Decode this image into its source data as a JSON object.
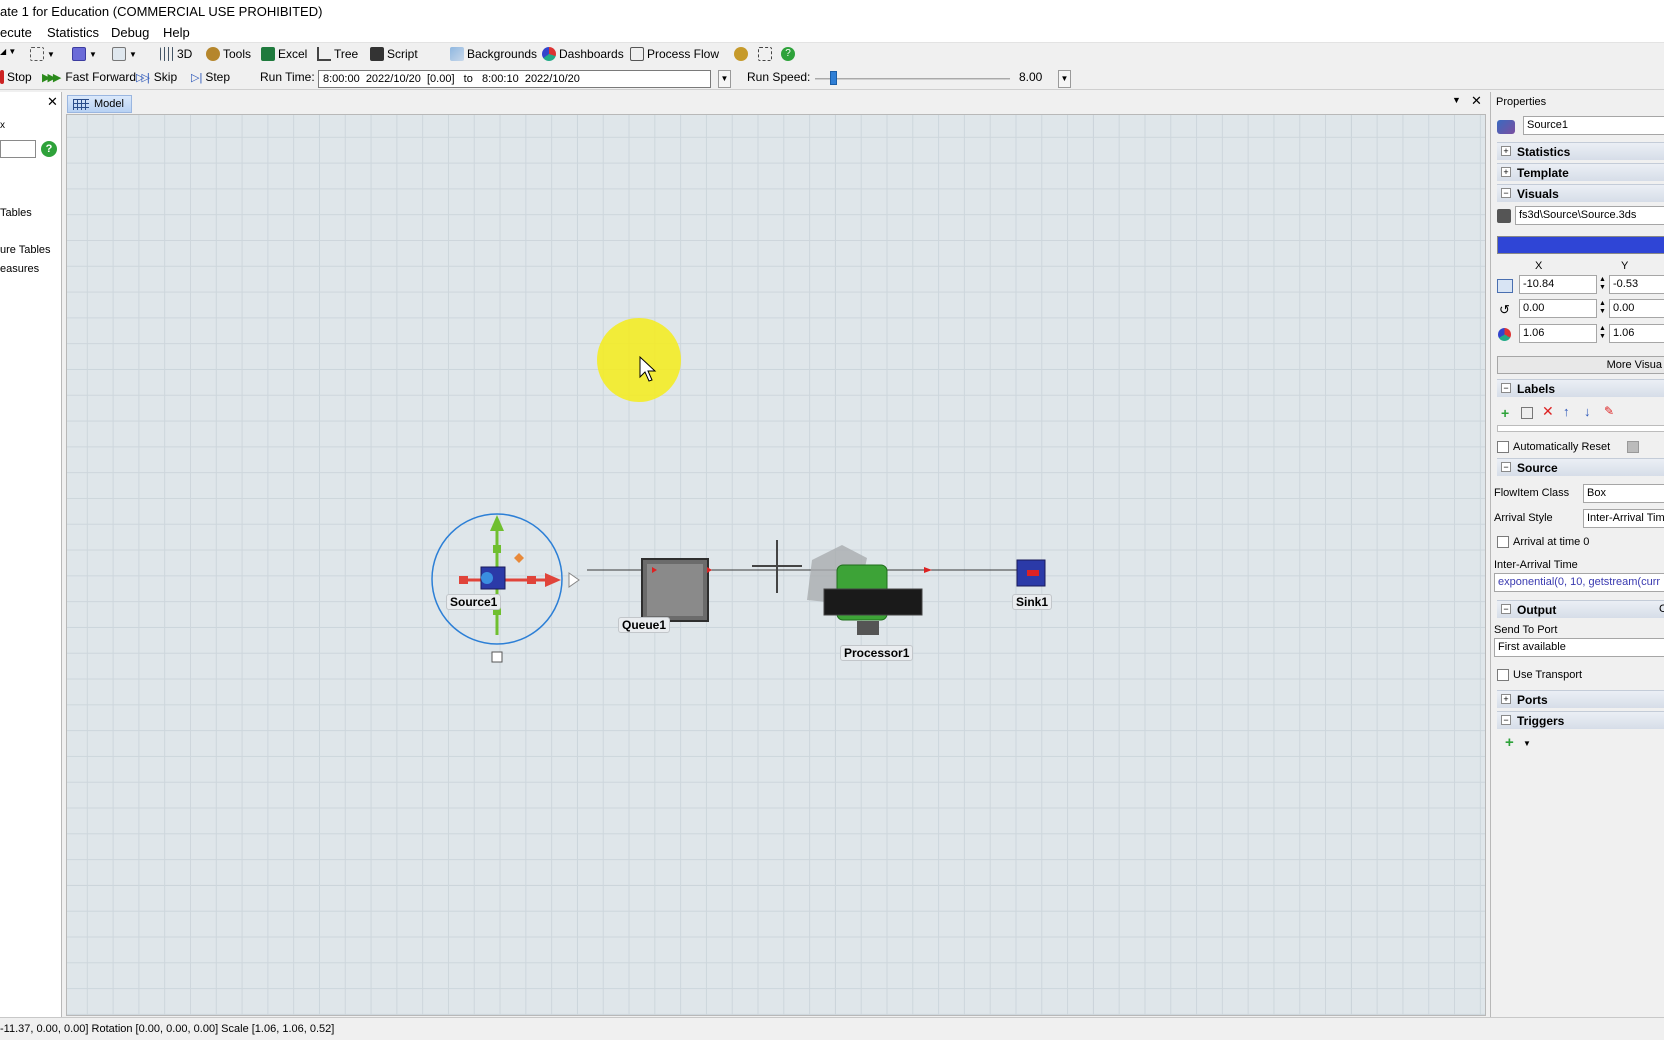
{
  "window": {
    "title": "ate 1 for Education (COMMERCIAL USE PROHIBITED)"
  },
  "menu": [
    "ecute",
    "Statistics",
    "Debug",
    "Help"
  ],
  "toolbar": {
    "view_3d": "3D",
    "tools": "Tools",
    "excel": "Excel",
    "tree": "Tree",
    "script": "Script",
    "backgrounds": "Backgrounds",
    "dashboards": "Dashboards",
    "process_flow": "Process Flow"
  },
  "run_controls": {
    "stop": "Stop",
    "fast_forward": "Fast Forward",
    "skip": "Skip",
    "step": "Step",
    "run_time_label": "Run Time:",
    "run_time_value": "8:00:00  2022/10/20  [0.00]   to   8:00:10  2022/10/20",
    "run_speed_label": "Run Speed:",
    "run_speed_value": "8.00",
    "run_speed_slider_fraction": 0.09
  },
  "left_panel": {
    "items": [
      "Tables",
      "ure Tables",
      "easures"
    ]
  },
  "model_tab": {
    "label": "Model"
  },
  "model": {
    "objects": [
      {
        "name": "Source1"
      },
      {
        "name": "Queue1"
      },
      {
        "name": "Processor1"
      },
      {
        "name": "Sink1"
      }
    ]
  },
  "properties": {
    "header": "Properties",
    "object_name": "Source1",
    "sections": {
      "statistics": "Statistics",
      "template": "Template",
      "visuals": "Visuals",
      "labels": "Labels",
      "source": "Source",
      "output": "Output",
      "ports": "Ports",
      "triggers": "Triggers"
    },
    "visuals": {
      "shape": "fs3d\\Source\\Source.3ds",
      "color": "#2f45d6",
      "col_x": "X",
      "col_y": "Y",
      "pos_x": "-10.84",
      "pos_y": "-0.53",
      "rot_x": "0.00",
      "rot_y": "0.00",
      "scale_x": "1.06",
      "scale_y": "1.06",
      "more_visuals": "More Visua"
    },
    "labels": {
      "auto_reset": "Automatically Reset"
    },
    "source": {
      "flowitem_class_label": "FlowItem Class",
      "flowitem_class_value": "Box",
      "arrival_style_label": "Arrival Style",
      "arrival_style_value": "Inter-Arrival Tim",
      "arrival_at_time0": "Arrival at time 0",
      "inter_arrival_label": "Inter-Arrival Time",
      "inter_arrival_value": "exponential(0, 10, getstream(curr"
    },
    "output": {
      "corner": "Co",
      "send_to_port_label": "Send To Port",
      "send_to_port_value": "First available",
      "use_transport": "Use Transport"
    }
  },
  "status": {
    "text": "-11.37, 0.00, 0.00]  Rotation [0.00, 0.00, 0.00]  Scale [1.06, 1.06, 0.52]"
  }
}
